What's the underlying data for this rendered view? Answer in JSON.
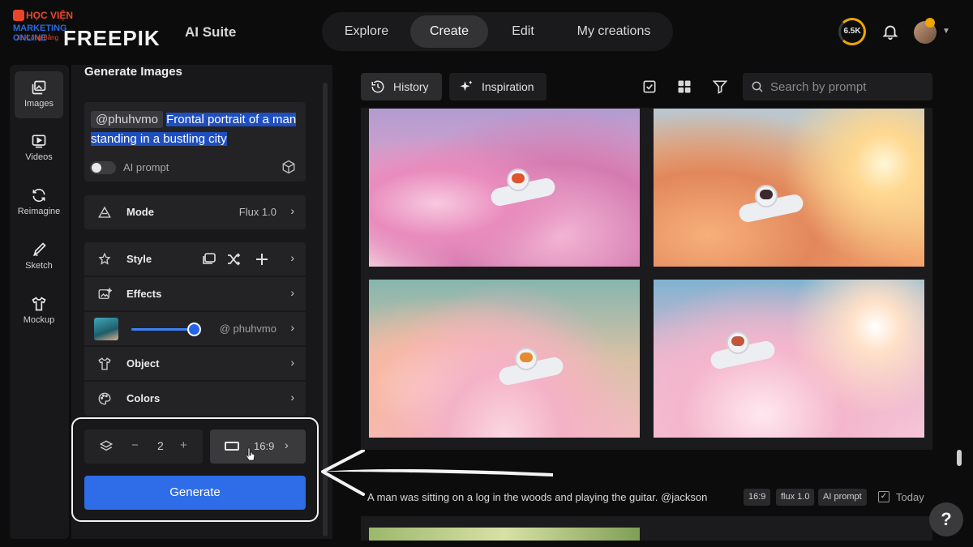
{
  "brand": {
    "logo": "FREEPIK",
    "suite": "AI Suite",
    "watermark_line1": "HỌC VIỆN",
    "watermark_line2": "MARKETING ONLINE",
    "watermark_line3": "Xa Công Bằng"
  },
  "nav": {
    "tabs": [
      {
        "label": "Explore"
      },
      {
        "label": "Create",
        "active": true
      },
      {
        "label": "Edit"
      },
      {
        "label": "My creations"
      }
    ]
  },
  "header": {
    "credits": "6.5K"
  },
  "rail": {
    "items": [
      {
        "label": "Images",
        "icon": "images-icon",
        "active": true
      },
      {
        "label": "Videos",
        "icon": "videos-icon"
      },
      {
        "label": "Reimagine",
        "icon": "reimagine-icon"
      },
      {
        "label": "Sketch",
        "icon": "sketch-icon"
      },
      {
        "label": "Mockup",
        "icon": "mockup-icon"
      }
    ]
  },
  "panel": {
    "title": "Generate Images",
    "prompt": {
      "mention": "@phuhvmo",
      "text": "Frontal portrait of a man standing in a bustling city",
      "ai_prompt_label": "AI prompt",
      "ai_prompt_on": false
    },
    "mode": {
      "label": "Mode",
      "value": "Flux 1.0"
    },
    "style": {
      "label": "Style"
    },
    "effects": {
      "label": "Effects"
    },
    "character": {
      "value": "@ phuhvmo",
      "strength": 0.9
    },
    "object": {
      "label": "Object"
    },
    "colors": {
      "label": "Colors"
    },
    "quantity": {
      "minus": "−",
      "value": "2",
      "plus": "+"
    },
    "aspect": {
      "label": "16:9"
    },
    "generate": "Generate"
  },
  "main": {
    "toolbar": {
      "history": "History",
      "inspiration": "Inspiration",
      "search_placeholder": "Search by prompt"
    },
    "caption": "A man was sitting on a log in the woods and playing the guitar. @jackson",
    "tags": [
      "16:9",
      "flux 1.0",
      "AI prompt"
    ],
    "date_label": "Today",
    "help": "?"
  },
  "colors": {
    "accent_blue": "#2f6de8",
    "highlight": "#1f4fbf",
    "credits_ring": "#f0a500"
  }
}
